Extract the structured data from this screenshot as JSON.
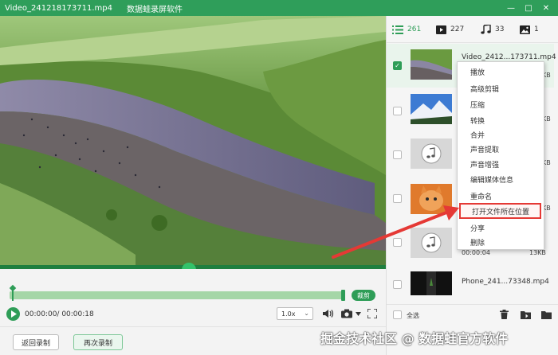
{
  "window": {
    "file_title": "Video_241218173711.mp4",
    "app_title": "数据蛙录屏软件",
    "buttons": [
      "—",
      "□",
      "✕"
    ]
  },
  "tabs": [
    {
      "icon": "list-icon",
      "count": "261",
      "active": true
    },
    {
      "icon": "video-icon",
      "count": "227",
      "active": false
    },
    {
      "icon": "music-icon",
      "count": "33",
      "active": false
    },
    {
      "icon": "image-icon",
      "count": "1",
      "active": false
    }
  ],
  "file_list": [
    {
      "name": "Video_2412...173711.mp4",
      "meta": "",
      "size": "KB",
      "checked": true,
      "thumb": "landscape"
    },
    {
      "name": "",
      "meta": "",
      "size": "KB",
      "checked": false,
      "thumb": "mountain"
    },
    {
      "name": "",
      "meta": "",
      "size": "KB",
      "checked": false,
      "thumb": "audio"
    },
    {
      "name": "",
      "meta": "",
      "size": "KB",
      "checked": false,
      "thumb": "cat"
    },
    {
      "name": "",
      "meta": "00:00:04",
      "size": "13KB",
      "checked": false,
      "thumb": "audio"
    },
    {
      "name": "Phone_241...73348.mp4",
      "meta": "",
      "size": "",
      "checked": false,
      "thumb": "dark"
    }
  ],
  "context_menu": [
    {
      "label": "播放"
    },
    {
      "label": "高级剪辑"
    },
    {
      "label": "压缩"
    },
    {
      "label": "转换"
    },
    {
      "label": "合并"
    },
    {
      "label": "声音提取"
    },
    {
      "label": "声音增强"
    },
    {
      "label": "编辑媒体信息"
    },
    {
      "label": "重命名"
    },
    {
      "label": "打开文件所在位置",
      "highlighted": true
    },
    {
      "label": "分享"
    },
    {
      "label": "删除"
    }
  ],
  "player": {
    "cut_label": "裁剪",
    "time": "00:00:00/ 00:00:18",
    "speed": "1.0x"
  },
  "bottom": {
    "back_label": "返回录制",
    "again_label": "再次录制"
  },
  "panel": {
    "select_all": "全选"
  },
  "watermark": "掘金技术社区 @ 数据蛙官方软件",
  "colors": {
    "accent": "#2e9d57",
    "highlight": "#e53935"
  }
}
